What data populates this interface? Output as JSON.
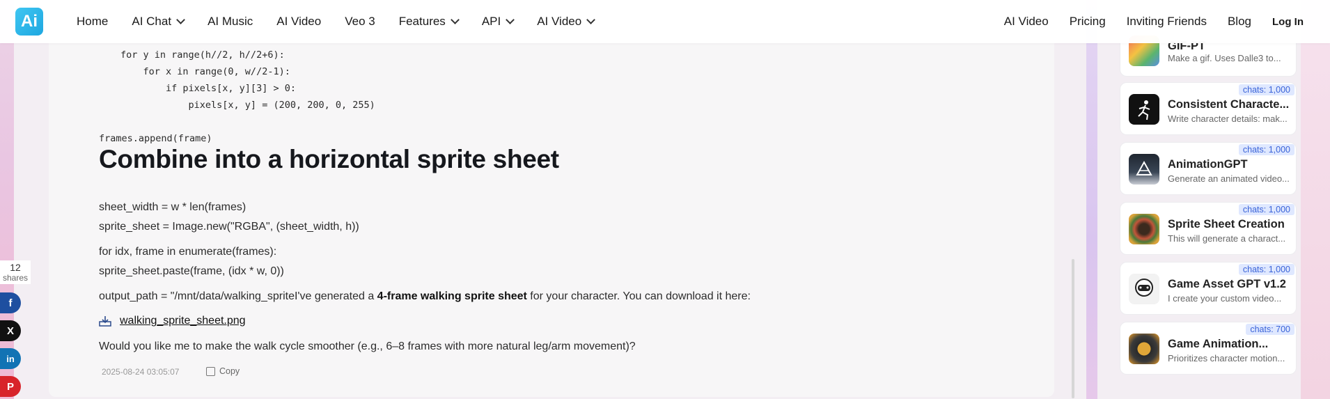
{
  "header": {
    "logo_text": "Ai",
    "nav": [
      {
        "label": "Home",
        "dropdown": false
      },
      {
        "label": "AI Chat",
        "dropdown": true
      },
      {
        "label": "AI Music",
        "dropdown": false
      },
      {
        "label": "AI Video",
        "dropdown": false
      },
      {
        "label": "Veo 3",
        "dropdown": false
      },
      {
        "label": "Features",
        "dropdown": true
      },
      {
        "label": "API",
        "dropdown": true
      },
      {
        "label": "AI Video",
        "dropdown": true
      }
    ],
    "nav_right": [
      {
        "label": "AI Video"
      },
      {
        "label": "Pricing"
      },
      {
        "label": "Inviting Friends"
      },
      {
        "label": "Blog"
      }
    ],
    "login_label": "Log In"
  },
  "content": {
    "code_lines": [
      "for y in range(h//2, h//2+6):",
      "    for x in range(0, w//2-1):",
      "        if pixels[x, y][3] > 0:",
      "            pixels[x, y] = (200, 200, 0, 255)"
    ],
    "append_line": "frames.append(frame)",
    "heading": "Combine into a horizontal sprite sheet",
    "para1_line1": "sheet_width = w * len(frames)",
    "para1_line2": "sprite_sheet = Image.new(\"RGBA\", (sheet_width, h))",
    "para2_line1": "for idx, frame in enumerate(frames):",
    "para2_line2": "sprite_sheet.paste(frame, (idx * w, 0))",
    "output_prefix": "output_path = \"/mnt/data/walking_spriteI've generated a ",
    "output_bold": "4-frame walking sprite sheet",
    "output_suffix": " for your character. You can download it here:",
    "file_link": "walking_sprite_sheet.png",
    "question": "Would you like me to make the walk cycle smoother (e.g., 6–8 frames with more natural leg/arm movement)?",
    "timestamp": "2025-08-24 03:05:07",
    "copy_label": "Copy"
  },
  "share": {
    "count": "12",
    "label": "shares",
    "buttons": [
      {
        "name": "facebook",
        "glyph": "f",
        "color": "#1e4fa0"
      },
      {
        "name": "x",
        "glyph": "X",
        "color": "#111111"
      },
      {
        "name": "linkedin",
        "glyph": "in",
        "color": "#1273b4"
      },
      {
        "name": "pinterest",
        "glyph": "P",
        "color": "#d8232a"
      }
    ]
  },
  "gpts": [
    {
      "name": "GIF-PT",
      "desc": "Make a gif. Uses Dalle3 to...",
      "badge": "",
      "icon": "gif-pt-thumb"
    },
    {
      "name": "Consistent Characte...",
      "desc": "Write character details: mak...",
      "badge": "chats: 1,000",
      "icon": "consistent-character-thumb"
    },
    {
      "name": "AnimationGPT",
      "desc": "Generate an animated video...",
      "badge": "chats: 1,000",
      "icon": "animationgpt-thumb"
    },
    {
      "name": "Sprite Sheet Creation",
      "desc": "This will generate a charact...",
      "badge": "chats: 1,000",
      "icon": "sprite-sheet-thumb"
    },
    {
      "name": "Game Asset GPT v1.2",
      "desc": "I create your custom video...",
      "badge": "chats: 1,000",
      "icon": "game-asset-thumb"
    },
    {
      "name": "Game Animation...",
      "desc": "Prioritizes character motion...",
      "badge": "chats: 700",
      "icon": "game-animation-thumb"
    }
  ]
}
